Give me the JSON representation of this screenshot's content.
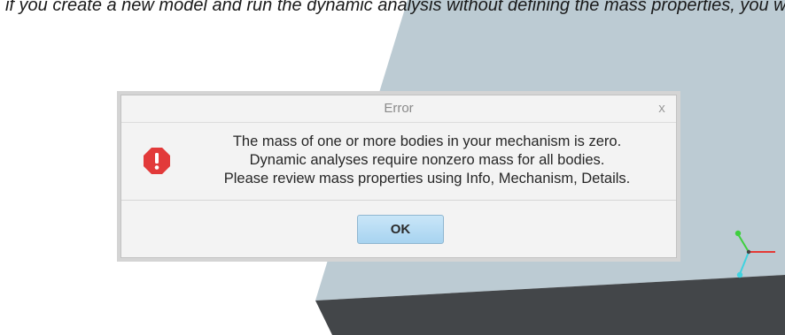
{
  "caption": {
    "text": "if you create a new model and run the dynamic analysis without defining the mass properties, you will get the following error message:"
  },
  "dialog": {
    "title": "Error",
    "close_label": "x",
    "message_lines": [
      "The mass of one or more bodies in your mechanism is zero.",
      "Dynamic analyses require nonzero mass for all bodies.",
      "Please review mass properties using Info, Mechanism, Details."
    ],
    "ok_label": "OK"
  },
  "icons": {
    "error": "error-icon",
    "triad": "coordinate-triad-icon"
  },
  "colors": {
    "background": "#ffffff",
    "model_top": "#bccbd3",
    "model_side": "#434649",
    "error_red": "#e23a3a",
    "button_blue": "#b4dbf4",
    "axis_x": "#e53935",
    "axis_y": "#3ecf3e",
    "axis_z": "#3fd3e0"
  }
}
